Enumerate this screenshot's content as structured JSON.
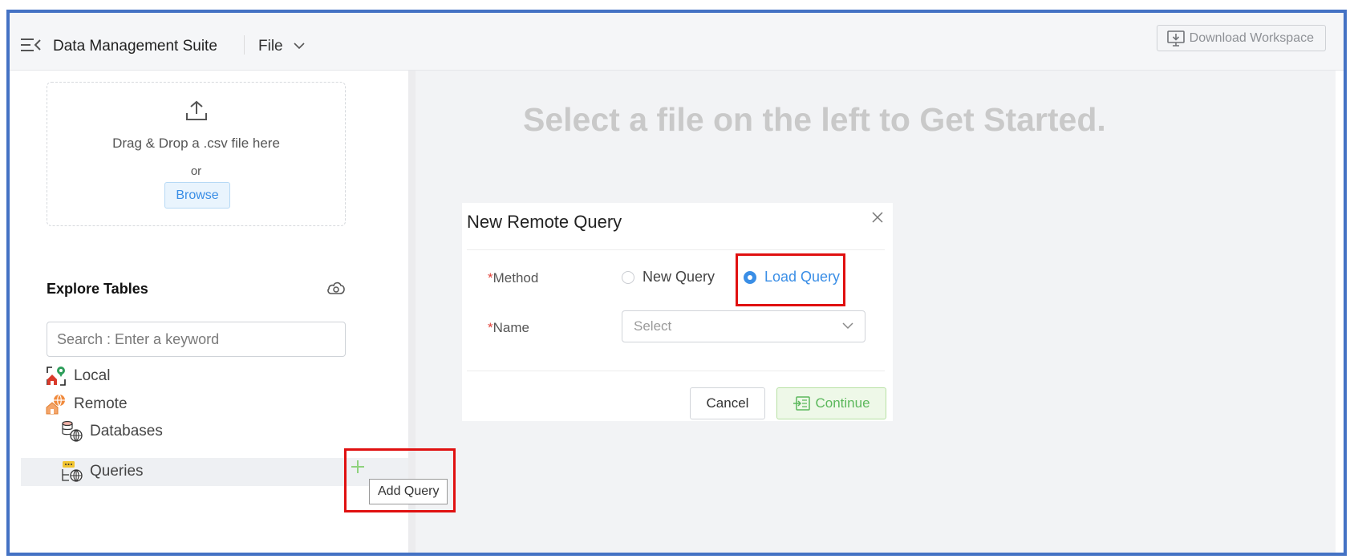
{
  "header": {
    "app_title": "Data Management Suite",
    "file_menu_label": "File",
    "download_label": "Download Workspace"
  },
  "upload": {
    "drop_text": "Drag & Drop a .csv file here",
    "or_text": "or",
    "browse_label": "Browse"
  },
  "explore": {
    "title": "Explore Tables",
    "search_placeholder": "Search : Enter a keyword"
  },
  "tree": {
    "local": "Local",
    "remote": "Remote",
    "databases": "Databases",
    "queries": "Queries"
  },
  "tooltip": {
    "add_query": "Add Query"
  },
  "main": {
    "empty_message": "Select a file on the left to Get Started."
  },
  "dialog": {
    "title": "New Remote Query",
    "method_label": "Method",
    "method_options": [
      "New Query",
      "Load Query"
    ],
    "selected_method": "Load Query",
    "name_label": "Name",
    "name_placeholder": "Select",
    "required_marker": "*",
    "cancel_label": "Cancel",
    "continue_label": "Continue"
  },
  "colors": {
    "accent_blue": "#3a8ee6",
    "success_green": "#5cb85c",
    "highlight_red": "#e01010",
    "frame_blue": "#4472c4"
  }
}
